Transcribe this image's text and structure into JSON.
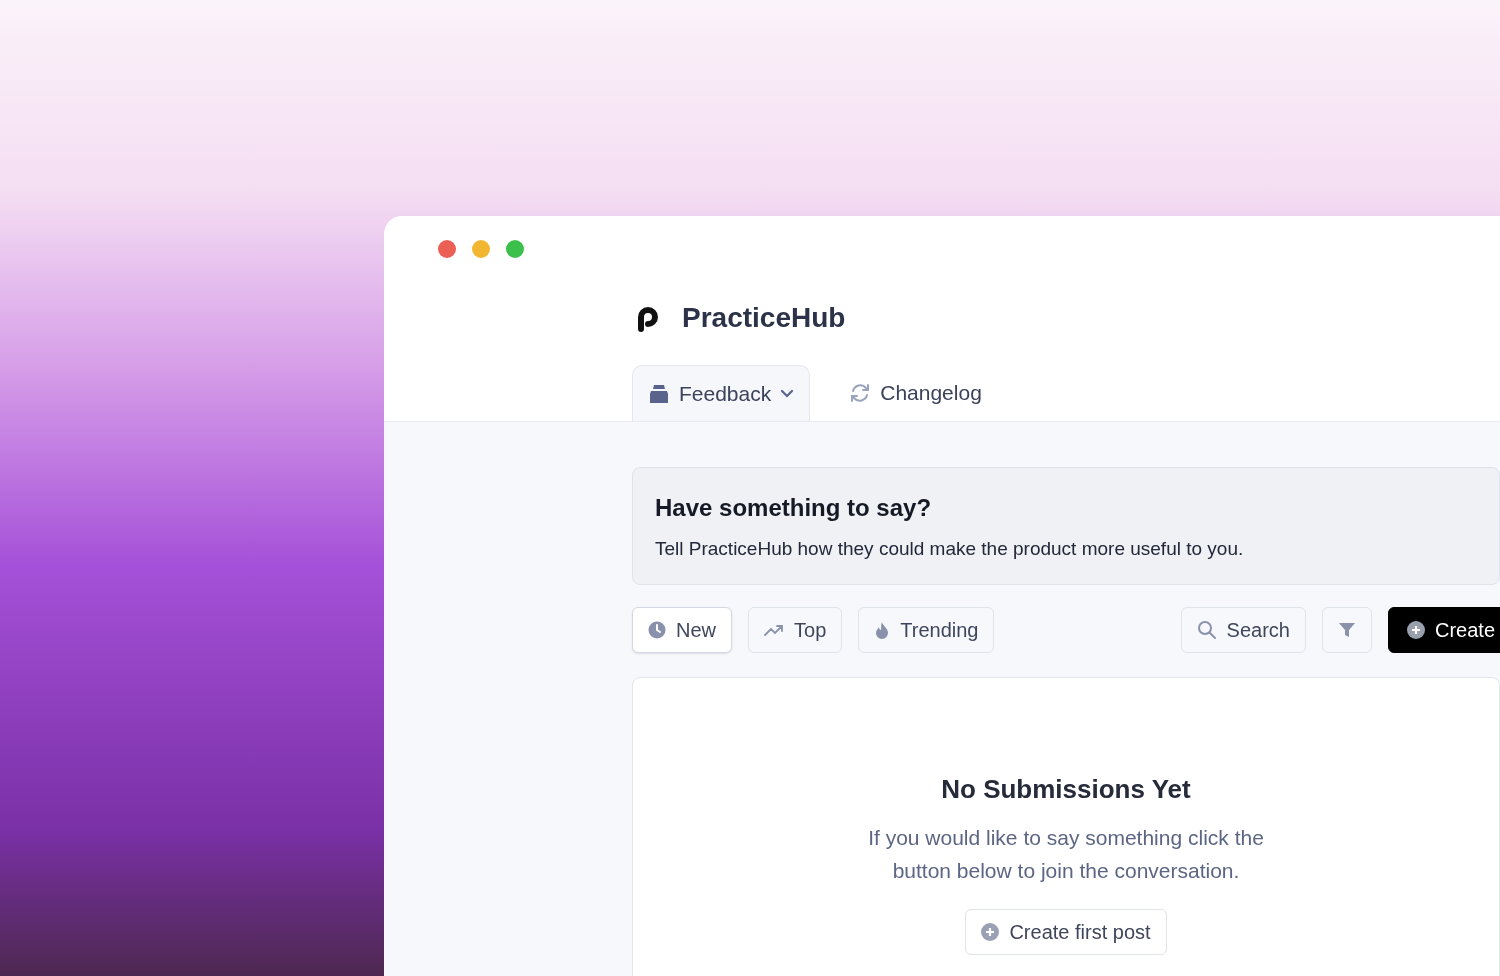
{
  "brand": "PracticeHub",
  "tabs": [
    {
      "label": "Feedback",
      "selected": true,
      "has_menu": true
    },
    {
      "label": "Changelog",
      "selected": false,
      "has_menu": false
    }
  ],
  "banner": {
    "title": "Have something to say?",
    "text": "Tell PracticeHub how they could make the product more useful to you."
  },
  "sort_buttons": [
    {
      "label": "New",
      "selected": true
    },
    {
      "label": "Top",
      "selected": false
    },
    {
      "label": "Trending",
      "selected": false
    }
  ],
  "search_button": "Search",
  "create_button": "Create",
  "empty_state": {
    "title": "No Submissions Yet",
    "text": "If you would like to say something click the button below to join the conversation.",
    "button": "Create first post"
  }
}
